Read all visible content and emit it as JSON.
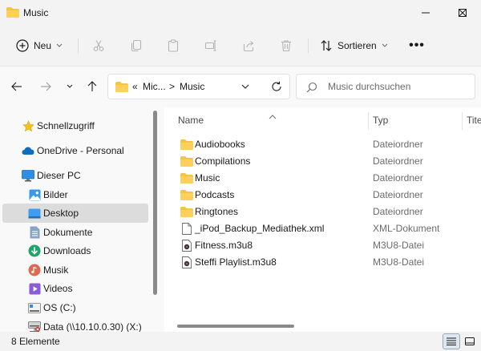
{
  "window": {
    "title": "Music"
  },
  "toolbar": {
    "new_label": "Neu",
    "sort_label": "Sortieren",
    "more_label": "•••"
  },
  "address": {
    "overflow": "«",
    "segments": [
      "Mic...",
      "Music"
    ],
    "separator": ">"
  },
  "search": {
    "placeholder": "Music durchsuchen"
  },
  "sidebar": {
    "items": [
      {
        "label": "Schnellzugriff",
        "icon": "star-icon"
      },
      {
        "label": "OneDrive - Personal",
        "icon": "cloud-icon"
      },
      {
        "label": "Dieser PC",
        "icon": "monitor-icon"
      },
      {
        "label": "Bilder",
        "icon": "pictures-icon"
      },
      {
        "label": "Desktop",
        "icon": "desktop-icon",
        "selected": true
      },
      {
        "label": "Dokumente",
        "icon": "documents-icon"
      },
      {
        "label": "Downloads",
        "icon": "download-icon"
      },
      {
        "label": "Musik",
        "icon": "music-icon"
      },
      {
        "label": "Videos",
        "icon": "videos-icon"
      },
      {
        "label": "OS (C:)",
        "icon": "drive-icon"
      },
      {
        "label": "Data (\\\\10.10.0.30) (X:)",
        "icon": "network-drive-icon"
      }
    ]
  },
  "table": {
    "columns": [
      "Name",
      "Typ",
      "Tite"
    ],
    "rows": [
      {
        "name": "Audiobooks",
        "type": "Dateiordner",
        "icon": "folder-icon"
      },
      {
        "name": "Compilations",
        "type": "Dateiordner",
        "icon": "folder-icon"
      },
      {
        "name": "Music",
        "type": "Dateiordner",
        "icon": "folder-icon"
      },
      {
        "name": "Podcasts",
        "type": "Dateiordner",
        "icon": "folder-icon"
      },
      {
        "name": "Ringtones",
        "type": "Dateiordner",
        "icon": "folder-icon"
      },
      {
        "name": "_iPod_Backup_Mediathek.xml",
        "type": "XML-Dokument",
        "icon": "file-icon"
      },
      {
        "name": "Fitness.m3u8",
        "type": "M3U8-Datei",
        "icon": "playlist-file-icon"
      },
      {
        "name": "Steffi Playlist.m3u8",
        "type": "M3U8-Datei",
        "icon": "playlist-file-icon"
      }
    ]
  },
  "status": {
    "count": "8 Elemente"
  },
  "colors": {
    "folder": "#f6c443",
    "accent": "#0067c0",
    "selected": "#dcdcdc"
  }
}
